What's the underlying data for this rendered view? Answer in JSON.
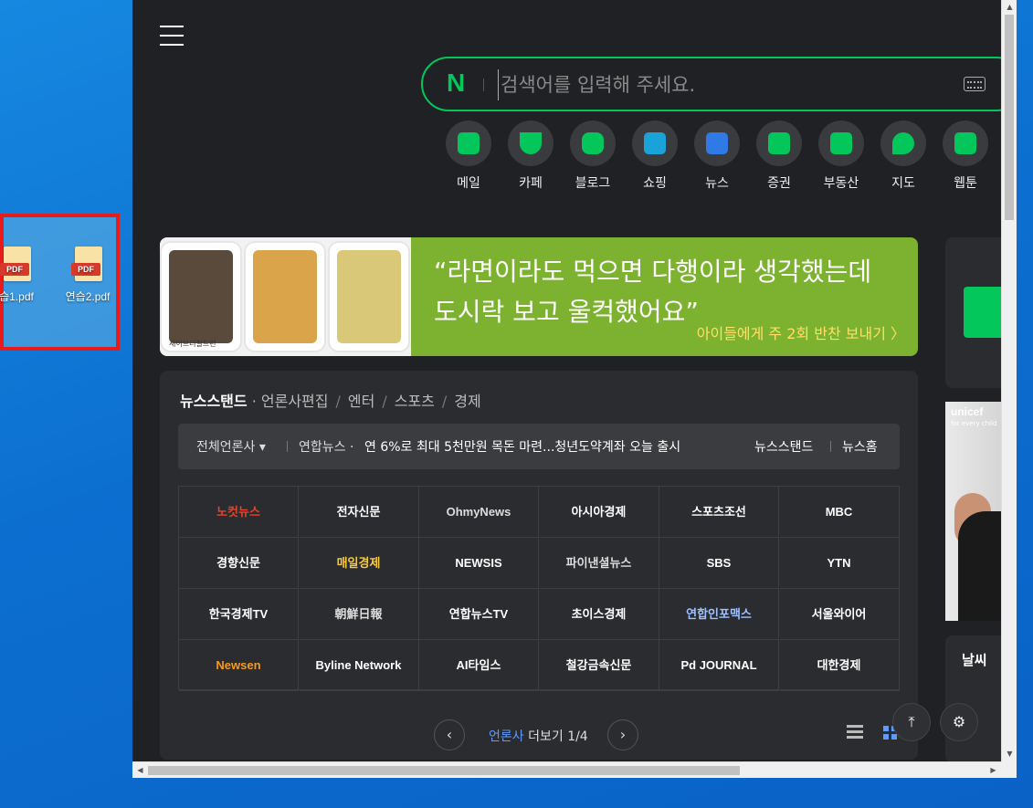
{
  "desktop": {
    "files": [
      {
        "name": "습1.pdf",
        "badge": "PDF"
      },
      {
        "name": "연습2.pdf",
        "badge": "PDF"
      }
    ]
  },
  "browser": {
    "search": {
      "placeholder": "검색어를 입력해 주세요.",
      "logo": "N"
    },
    "shortcuts": [
      {
        "label": "메일",
        "icon": "mail-icon",
        "color": "#03c75a"
      },
      {
        "label": "카페",
        "icon": "cafe-icon",
        "color": "#03c75a"
      },
      {
        "label": "블로그",
        "icon": "blog-icon",
        "color": "#03c75a"
      },
      {
        "label": "쇼핑",
        "icon": "shopping-icon",
        "color": "#1aa3d9"
      },
      {
        "label": "뉴스",
        "icon": "news-icon",
        "color": "#2f7ae5"
      },
      {
        "label": "증권",
        "icon": "stock-icon",
        "color": "#03c75a"
      },
      {
        "label": "부동산",
        "icon": "realestate-icon",
        "color": "#03c75a"
      },
      {
        "label": "지도",
        "icon": "map-icon",
        "color": "#03c75a"
      },
      {
        "label": "웹툰",
        "icon": "webtoon-icon",
        "color": "#03c75a"
      }
    ],
    "banner": {
      "quote_line1": "“라면이라도 먹으면 다행이라 생각했는데",
      "quote_line2": "도시락 보고 울컥했어요”",
      "cta": "아이들에게 주 2회 반찬 보내기 〉",
      "stamp": "세이브더칠드런"
    },
    "newsstand": {
      "title": "뉴스스탠드",
      "dot": "·",
      "tabs": [
        "언론사편집",
        "엔터",
        "스포츠",
        "경제"
      ],
      "tab_sep": "/",
      "ticker": {
        "all_label": "전체언론사 ▾",
        "source": "연합뉴스 ·",
        "headline": "연 6%로 최대 5천만원 목돈 마련...청년도약계좌 오늘 출시",
        "link1": "뉴스스탠드",
        "link2": "뉴스홈"
      },
      "press": [
        "노컷뉴스",
        "전자신문",
        "OhmyNews",
        "아시아경제",
        "스포츠조선",
        "MBC",
        "경향신문",
        "매일경제",
        "NEWSIS",
        "파이낸셜뉴스",
        "SBS",
        "YTN",
        "한국경제TV",
        "朝鮮日報",
        "연합뉴스TV",
        "초이스경제",
        "연합인포맥스",
        "서울와이어",
        "Newsen",
        "Byline Network",
        "AI타임스",
        "철강금속신문",
        "Pd JOURNAL",
        "대한경제"
      ],
      "pager": {
        "label": "언론사",
        "more": "더보기",
        "page": "1/4",
        "prev": "‹",
        "next": "›"
      }
    },
    "right": {
      "ad_brand": "unicef",
      "ad_sub": "for every child",
      "weather_title": "날씨"
    },
    "float_buttons": {
      "top": "⤒",
      "settings": "⚙"
    }
  }
}
